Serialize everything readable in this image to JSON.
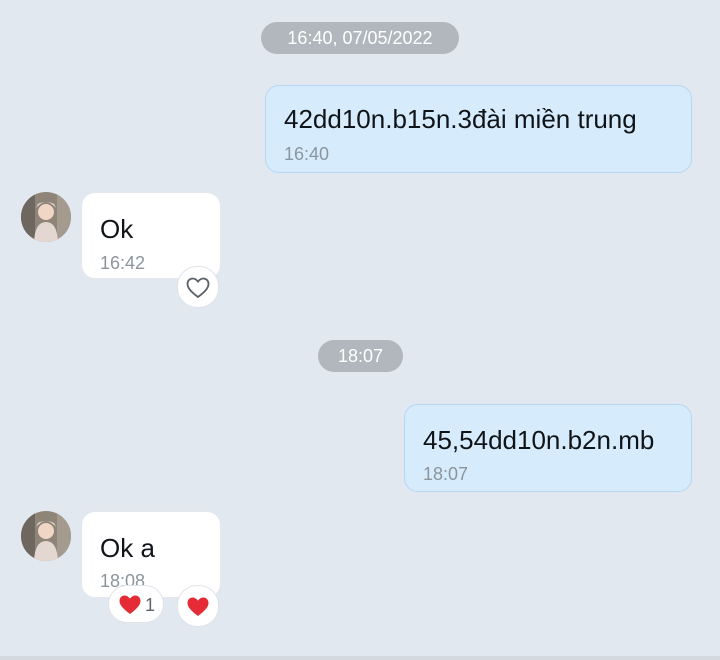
{
  "colors": {
    "background": "#e2e8ef",
    "sent_bubble": "#d6ecfc",
    "received_bubble": "#ffffff",
    "date_pill": "#b1b7bd",
    "heart_red": "#e52b35"
  },
  "conversation": {
    "separators": [
      {
        "label": "16:40, 07/05/2022"
      },
      {
        "label": "18:07"
      }
    ],
    "messages": [
      {
        "direction": "sent",
        "text": "42dd10n.b15n.3đài miền trung",
        "time": "16:40"
      },
      {
        "direction": "received",
        "text": "Ok",
        "time": "16:42",
        "reaction_icon": "heart-outline-icon"
      },
      {
        "direction": "sent",
        "text": "45,54dd10n.b2n.mb",
        "time": "18:07"
      },
      {
        "direction": "received",
        "text": "Ok a",
        "time": "18:08",
        "reactions": [
          {
            "icon": "heart-icon",
            "count": "1"
          }
        ],
        "reaction_icon": "heart-filled-icon"
      }
    ]
  }
}
